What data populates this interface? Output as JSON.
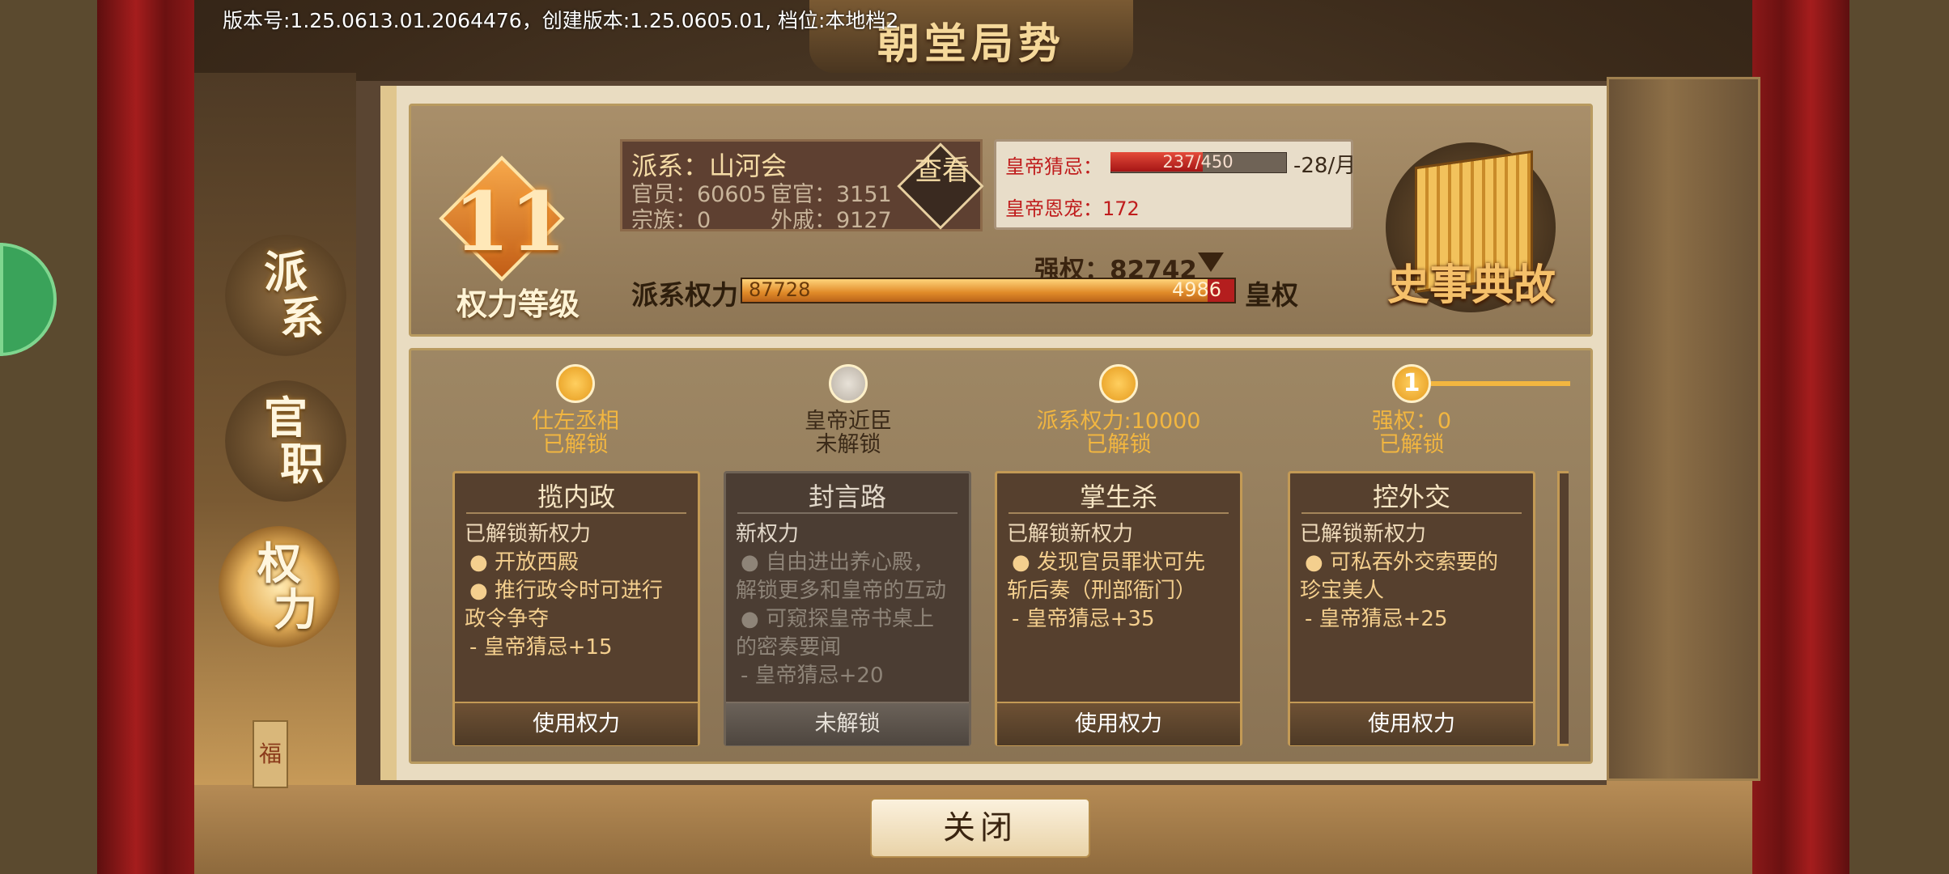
{
  "version_text": "版本号:1.25.0613.01.2064476，创建版本:1.25.0605.01, 档位:本地档2",
  "title": "朝堂局势",
  "nav": [
    {
      "label_a": "派",
      "label_b": "系"
    },
    {
      "label_a": "官",
      "label_b": "职"
    },
    {
      "label_a": "权",
      "label_b": "力"
    }
  ],
  "fu_char": "福",
  "power_level": {
    "value": "11",
    "label": "权力等级"
  },
  "faction": {
    "name": "派系：山河会",
    "officials": "官员：60605",
    "eunuchs": "宦官：3151",
    "clan": "宗族：0",
    "consort_kin": "外戚：9127",
    "view_button": "查看"
  },
  "emperor": {
    "suspicion_label": "皇帝猜忌：",
    "suspicion_value": "237/450",
    "suspicion_fraction": 0.527,
    "suspicion_rate": "-28/月",
    "favor": "皇帝恩宠：172"
  },
  "strong_power": "强权：82742",
  "power_bar": {
    "left_label": "派系权力",
    "right_label": "皇权",
    "left_value": "87728",
    "right_value": "4986",
    "left_fraction": 0.946
  },
  "history_label": "史事典故",
  "tiers": [
    {
      "name": "仕左丞相",
      "status": "已解锁",
      "unlocked": true
    },
    {
      "name": "皇帝近臣",
      "status": "未解锁",
      "unlocked": false
    },
    {
      "name": "派系权力:10000",
      "status": "已解锁",
      "unlocked": true
    },
    {
      "name": "强权：0",
      "status": "已解锁",
      "unlocked": true,
      "badge": "1"
    }
  ],
  "cards": [
    {
      "title": "揽内政",
      "head": "已解锁新权力",
      "line1": "● 开放西殿",
      "line2": "● 推行政令时可进行",
      "line3": "政令争夺",
      "line4": "- 皇帝猜忌+15",
      "button": "使用权力"
    },
    {
      "title": "封言路",
      "head": "新权力",
      "line1": "● 自由进出养心殿，",
      "line2": "解锁更多和皇帝的互动",
      "line3": "● 可窥探皇帝书桌上",
      "line4": "的密奏要闻",
      "line5": "- 皇帝猜忌+20",
      "button": "未解锁"
    },
    {
      "title": "掌生杀",
      "head": "已解锁新权力",
      "line1": "● 发现官员罪状可先",
      "line2": "斩后奏（刑部衙门）",
      "line3": "- 皇帝猜忌+35",
      "button": "使用权力"
    },
    {
      "title": "控外交",
      "head": "已解锁新权力",
      "line1": "● 可私吞外交索要的",
      "line2": "珍宝美人",
      "line3": "- 皇帝猜忌+25",
      "button": "使用权力"
    }
  ],
  "close_button": "关闭",
  "colors": {
    "accent": "#f2b640",
    "danger": "#c01d1d",
    "panel": "#56402e"
  }
}
